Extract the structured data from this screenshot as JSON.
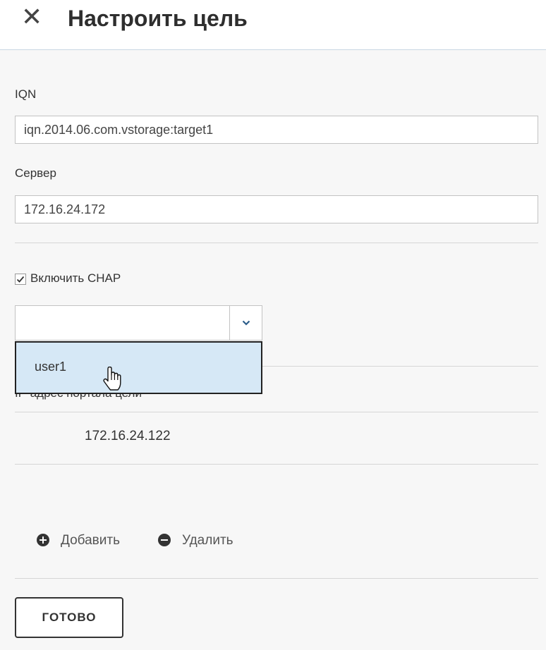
{
  "dialog": {
    "title": "Настроить цель",
    "close_icon": "close-icon"
  },
  "iqn": {
    "label": "IQN",
    "value": "iqn.2014.06.com.vstorage:target1"
  },
  "server": {
    "label": "Сервер",
    "value": "172.16.24.172"
  },
  "chap": {
    "checkbox_label": "Включить CHAP",
    "checked": true,
    "select_value": "",
    "options": [
      "user1"
    ]
  },
  "portals": {
    "header_partial": "IP-адрес портала цели",
    "rows": [
      "172.16.24.122"
    ]
  },
  "actions": {
    "add_label": "Добавить",
    "remove_label": "Удалить"
  },
  "footer": {
    "done_label": "ГОТОВО"
  }
}
